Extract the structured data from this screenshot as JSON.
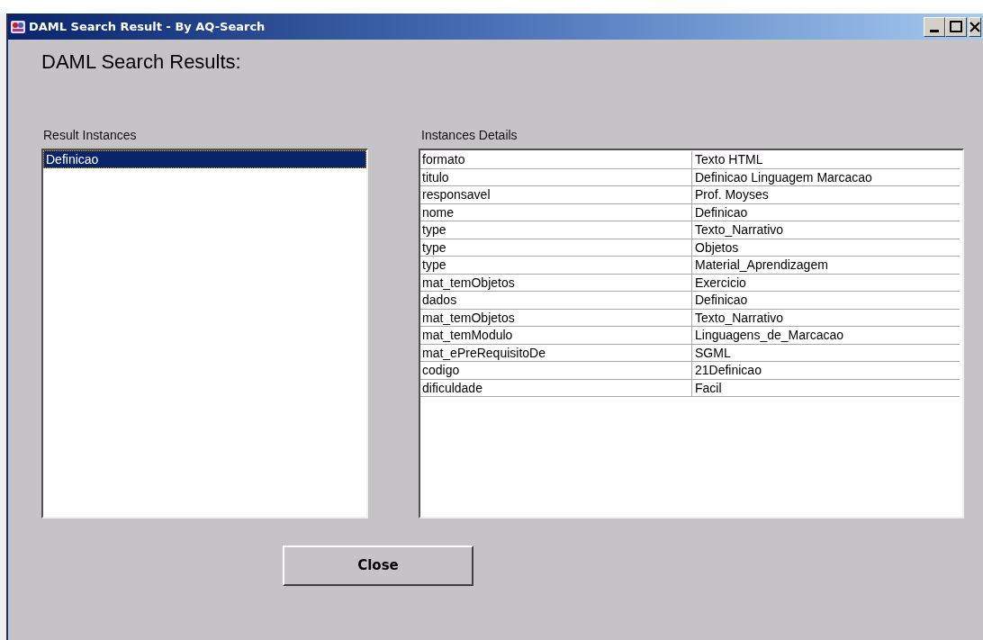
{
  "window": {
    "title": "DAML Search Result - By AQ-Search"
  },
  "heading": "DAML Search Results:",
  "result_instances": {
    "label": "Result Instances",
    "items": [
      {
        "text": "Definicao",
        "selected": true
      }
    ]
  },
  "instances_details": {
    "label": "Instances Details",
    "rows": [
      {
        "column_1": "formato",
        "column_2": "Texto HTML"
      },
      {
        "column_1": "titulo",
        "column_2": "Definicao Linguagem Marcacao"
      },
      {
        "column_1": "responsavel",
        "column_2": "Prof. Moyses"
      },
      {
        "column_1": "nome",
        "column_2": "Definicao"
      },
      {
        "column_1": "type",
        "column_2": "Texto_Narrativo"
      },
      {
        "column_1": "type",
        "column_2": "Objetos"
      },
      {
        "column_1": "type",
        "column_2": "Material_Aprendizagem"
      },
      {
        "column_1": "mat_temObjetos",
        "column_2": "Exercicio"
      },
      {
        "column_1": "dados",
        "column_2": "Definicao"
      },
      {
        "column_1": "mat_temObjetos",
        "column_2": "Texto_Narrativo"
      },
      {
        "column_1": "mat_temModulo",
        "column_2": "Linguagens_de_Marcacao"
      },
      {
        "column_1": "mat_ePreRequisitoDe",
        "column_2": "SGML"
      },
      {
        "column_1": "codigo",
        "column_2": "21Definicao"
      },
      {
        "column_1": "dificuldade",
        "column_2": "Facil"
      }
    ]
  },
  "buttons": [
    "Close"
  ]
}
